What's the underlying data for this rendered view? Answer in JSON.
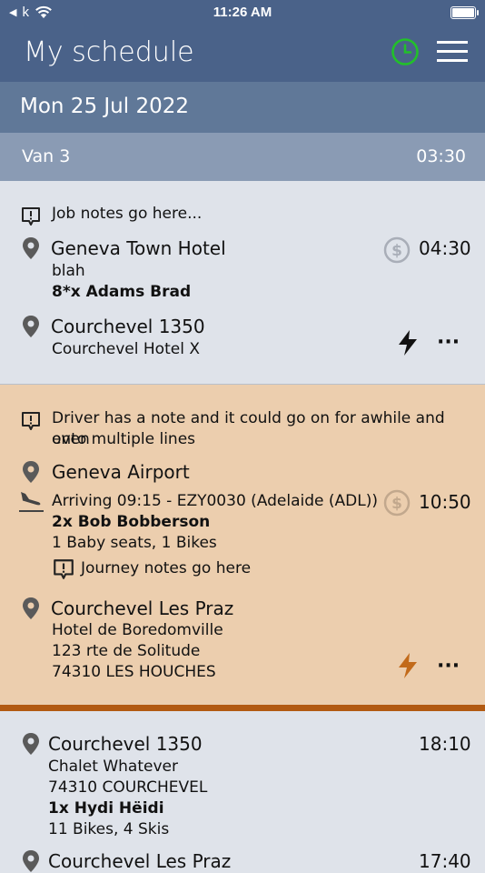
{
  "status_bar": {
    "back_label": "k",
    "time": "11:26 AM"
  },
  "header": {
    "title": "My schedule",
    "clock_icon_color": "#22c02a"
  },
  "date_bar": {
    "date": "Mon 25 Jul 2022"
  },
  "van_bar": {
    "van": "Van 3",
    "time": "03:30"
  },
  "jobs": [
    {
      "note": "Job notes go here...",
      "pickup": {
        "place": "Geneva Town Hotel",
        "detail": "blah",
        "passengers": "8*x Adams Brad",
        "time": "04:30"
      },
      "dropoff": {
        "place": "Courchevel 1350",
        "detail": "Courchevel Hotel X"
      },
      "more_label": "···"
    },
    {
      "note_line1": "Driver has a note and it could go on for awhile and even",
      "note_line2": "onto multiple lines",
      "pickup": {
        "place": "Geneva Airport",
        "flight": "Arriving 09:15 - EZY0030 (Adelaide (ADL))",
        "passengers": "2x Bob Bobberson",
        "extras": "1 Baby seats, 1 Bikes",
        "journey_note": "Journey notes go here",
        "time": "10:50"
      },
      "dropoff": {
        "place": "Courchevel Les Praz",
        "line1": "Hotel de Boredomville",
        "line2": "123 rte de Solitude",
        "line3": "74310 LES HOUCHES"
      },
      "more_label": "···",
      "accent_color": "#b25a12"
    },
    {
      "pickup": {
        "place": "Courchevel 1350",
        "line1": "Chalet Whatever",
        "line2": "74310 COURCHEVEL",
        "passengers": "1x Hydi Hëidi",
        "extras": "11 Bikes, 4 Skis",
        "time": "18:10"
      },
      "dropoff": {
        "place": "Courchevel Les Praz",
        "time": "17:40"
      }
    }
  ]
}
